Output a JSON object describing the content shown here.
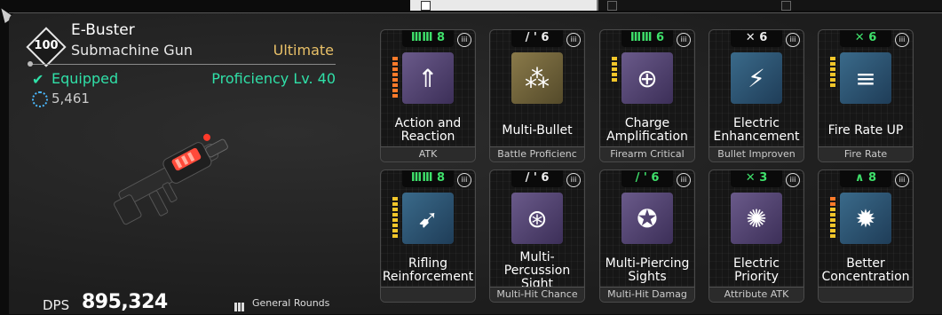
{
  "weapon": {
    "level": "100",
    "name": "E-Buster",
    "type": "Submachine Gun",
    "rarity": "Ultimate",
    "status": "Equipped",
    "proficiency": "Proficiency Lv. 40",
    "power": "5,461",
    "dps_label": "DPS",
    "dps_value": "895,324",
    "ammo": "General Rounds"
  },
  "modules": [
    {
      "cap": "8",
      "cap_icon": "green-bars",
      "name": "Action and Reaction",
      "sub": "ATK",
      "icon": "arrows-up-icon",
      "color": "purple",
      "bar": [
        "orange",
        "orange",
        "orange",
        "orange",
        "orange",
        "orange",
        "orange",
        "orange"
      ]
    },
    {
      "cap": "6",
      "cap_icon": "white-slash",
      "name": "Multi-Bullet",
      "sub": "Battle Proficienc",
      "icon": "multi-bullet-icon",
      "color": "gold",
      "bar": []
    },
    {
      "cap": "6",
      "cap_icon": "green-bars",
      "name": "Charge Amplification",
      "sub": "Firearm Critical",
      "icon": "charge-icon",
      "color": "purple",
      "bar": [
        "yellow",
        "yellow",
        "yellow",
        "yellow",
        "yellow"
      ]
    },
    {
      "cap": "6",
      "cap_icon": "white-x",
      "name": "Electric Enhancement",
      "sub": "Bullet Improven",
      "icon": "electric-icon",
      "color": "blue",
      "bar": []
    },
    {
      "cap": "6",
      "cap_icon": "green-x",
      "name": "Fire Rate UP",
      "sub": "Fire Rate",
      "icon": "fire-rate-icon",
      "color": "blue",
      "bar": [
        "yellow",
        "yellow",
        "yellow",
        "yellow",
        "yellow",
        "yellow"
      ]
    },
    {
      "cap": "8",
      "cap_icon": "green-bars",
      "name": "Rifling Reinforcement",
      "sub": "",
      "icon": "rifling-icon",
      "color": "blue",
      "bar": [
        "yellow",
        "yellow",
        "yellow",
        "yellow",
        "yellow",
        "yellow",
        "yellow",
        "yellow"
      ]
    },
    {
      "cap": "6",
      "cap_icon": "white-slash",
      "name": "Multi-Percussion Sight",
      "sub": "Multi-Hit Chance",
      "icon": "percussion-icon",
      "color": "purple",
      "bar": []
    },
    {
      "cap": "6",
      "cap_icon": "green-slash",
      "name": "Multi-Piercing Sights",
      "sub": "Multi-Hit Damag",
      "icon": "piercing-icon",
      "color": "purple",
      "bar": []
    },
    {
      "cap": "3",
      "cap_icon": "green-x",
      "name": "Electric Priority",
      "sub": "Attribute ATK",
      "icon": "electric-priority-icon",
      "color": "purple",
      "bar": []
    },
    {
      "cap": "8",
      "cap_icon": "green-arrow",
      "name": "Better Concentration",
      "sub": "",
      "icon": "concentration-icon",
      "color": "blue",
      "bar": [
        "orange",
        "orange",
        "yellow",
        "yellow",
        "yellow",
        "yellow",
        "yellow",
        "yellow"
      ]
    }
  ],
  "info_icon": "iii"
}
